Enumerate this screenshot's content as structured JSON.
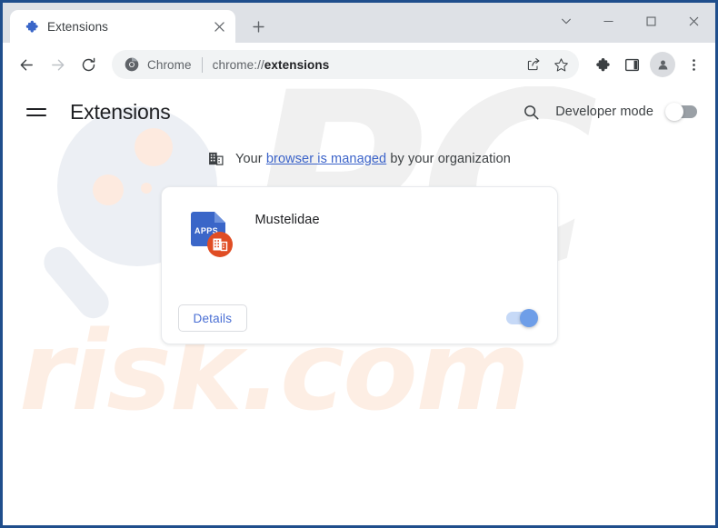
{
  "browser": {
    "tab": {
      "title": "Extensions",
      "favicon_icon": "puzzle-piece-icon",
      "close_icon": "close-icon"
    },
    "new_tab_icon": "plus-icon",
    "window_controls": {
      "tab_search_icon": "chevron-down-icon",
      "minimize_icon": "minimize-icon",
      "maximize_icon": "maximize-icon",
      "close_icon": "close-icon"
    },
    "toolbar": {
      "back_icon": "arrow-left-icon",
      "forward_icon": "arrow-right-icon",
      "reload_icon": "reload-icon",
      "omnibox": {
        "chrome_label": "Chrome",
        "url_prefix": "chrome://",
        "url_bold": "extensions",
        "chrome_logo_icon": "chrome-logo-icon",
        "share_icon": "share-icon",
        "bookmark_icon": "star-icon"
      },
      "extensions_icon": "puzzle-piece-icon",
      "side_panel_icon": "side-panel-icon",
      "profile_icon": "avatar-person-icon",
      "menu_icon": "three-dots-vertical-icon"
    }
  },
  "page": {
    "menu_icon": "hamburger-menu-icon",
    "title": "Extensions",
    "search_icon": "search-icon",
    "developer_mode": {
      "label": "Developer mode",
      "enabled": false
    },
    "managed_notice": {
      "icon": "enterprise-building-icon",
      "prefix": "Your ",
      "link_text": "browser is managed",
      "suffix": " by your organization"
    },
    "extensions": [
      {
        "name": "Mustelidae",
        "icon_label": "APPS",
        "icon_name": "apps-document-icon",
        "badge_icon": "enterprise-building-badge-icon",
        "details_label": "Details",
        "enabled": true
      }
    ],
    "watermark": {
      "top_text": "PC",
      "bottom_text": "risk.com",
      "decoration_icon": "magnifier-watermark-icon"
    }
  },
  "colors": {
    "accent_blue": "#4a6fd4",
    "link_blue": "#3b63c9",
    "tabstrip_gray": "#dee1e6",
    "omnibox_gray": "#f1f3f4",
    "icon_blue": "#3a66c8",
    "badge_orange": "#e04d24",
    "watermark_gray": "#f0f0f0",
    "watermark_peach": "#fdeee4",
    "frame_blue": "#1f4e8c"
  }
}
